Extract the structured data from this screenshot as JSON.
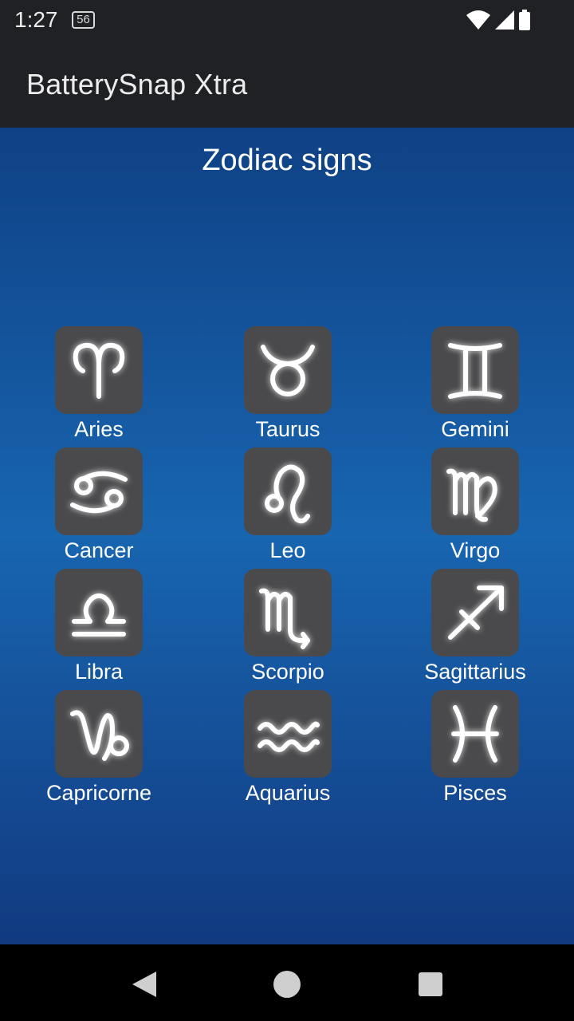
{
  "status_bar": {
    "time": "1:27",
    "badge": "56",
    "icons": [
      "wifi-icon",
      "signal-icon",
      "battery-icon"
    ]
  },
  "app_bar": {
    "title": "BatterySnap Xtra"
  },
  "main": {
    "title": "Zodiac signs",
    "signs": [
      {
        "label": "Aries",
        "icon": "aries-icon"
      },
      {
        "label": "Taurus",
        "icon": "taurus-icon"
      },
      {
        "label": "Gemini",
        "icon": "gemini-icon"
      },
      {
        "label": "Cancer",
        "icon": "cancer-icon"
      },
      {
        "label": "Leo",
        "icon": "leo-icon"
      },
      {
        "label": "Virgo",
        "icon": "virgo-icon"
      },
      {
        "label": "Libra",
        "icon": "libra-icon"
      },
      {
        "label": "Scorpio",
        "icon": "scorpio-icon"
      },
      {
        "label": "Sagittarius",
        "icon": "sagittarius-icon"
      },
      {
        "label": "Capricorne",
        "icon": "capricorn-icon"
      },
      {
        "label": "Aquarius",
        "icon": "aquarius-icon"
      },
      {
        "label": "Pisces",
        "icon": "pisces-icon"
      }
    ]
  },
  "nav_bar": {
    "buttons": [
      "back-icon",
      "home-icon",
      "recents-icon"
    ]
  },
  "colors": {
    "app_bar": "#202124",
    "gradient_top": "#0f4185",
    "gradient_mid": "#1865b0",
    "tile": "#4a4a4c",
    "text": "#ffffff"
  }
}
